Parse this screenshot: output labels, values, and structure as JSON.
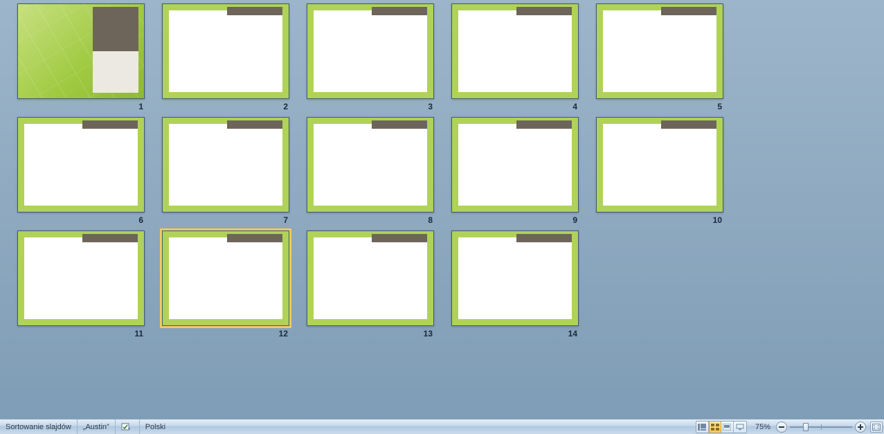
{
  "slides": [
    {
      "number": "1",
      "type": "title",
      "selected": false
    },
    {
      "number": "2",
      "type": "content",
      "selected": false
    },
    {
      "number": "3",
      "type": "content",
      "selected": false
    },
    {
      "number": "4",
      "type": "content",
      "selected": false
    },
    {
      "number": "5",
      "type": "content",
      "selected": false
    },
    {
      "number": "6",
      "type": "content",
      "selected": false
    },
    {
      "number": "7",
      "type": "content",
      "selected": false
    },
    {
      "number": "8",
      "type": "content",
      "selected": false
    },
    {
      "number": "9",
      "type": "content",
      "selected": false
    },
    {
      "number": "10",
      "type": "content",
      "selected": false
    },
    {
      "number": "11",
      "type": "content",
      "selected": false
    },
    {
      "number": "12",
      "type": "content",
      "selected": true
    },
    {
      "number": "13",
      "type": "content",
      "selected": false
    },
    {
      "number": "14",
      "type": "content",
      "selected": false
    }
  ],
  "statusbar": {
    "view_mode": "Sortowanie slajdów",
    "theme": "„Austin”",
    "language": "Polski",
    "zoom_label": "75%"
  }
}
